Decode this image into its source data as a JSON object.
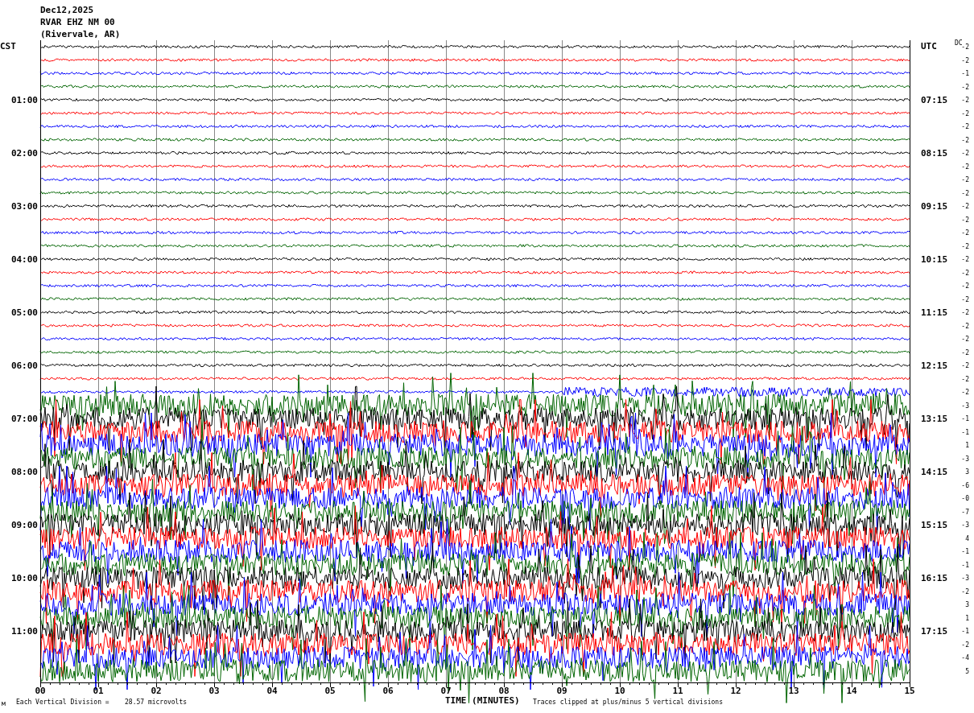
{
  "header": {
    "date": "Dec12,2025",
    "station": "RVAR EHZ NM 00",
    "location": "(Rivervale, AR)"
  },
  "left_zone": "CST",
  "right_zone": "UTC",
  "dc_heading": "DC",
  "traces": [
    {
      "color": "#000000",
      "kind": "quiet",
      "dc": "-2"
    },
    {
      "color": "#ff0000",
      "kind": "quiet",
      "dc": "-2"
    },
    {
      "color": "#0000ff",
      "kind": "quiet",
      "dc": "-1"
    },
    {
      "color": "#006400",
      "kind": "quiet",
      "dc": "-2"
    },
    {
      "color": "#000000",
      "kind": "quiet",
      "dc": "-2",
      "local_time": "01:00",
      "utc_time": "07:15"
    },
    {
      "color": "#ff0000",
      "kind": "quiet",
      "dc": "-2"
    },
    {
      "color": "#0000ff",
      "kind": "quiet",
      "dc": "-2"
    },
    {
      "color": "#006400",
      "kind": "quiet",
      "dc": "-2"
    },
    {
      "color": "#000000",
      "kind": "quiet",
      "dc": "-2",
      "local_time": "02:00",
      "utc_time": "08:15"
    },
    {
      "color": "#ff0000",
      "kind": "quiet",
      "dc": "-2"
    },
    {
      "color": "#0000ff",
      "kind": "quiet",
      "dc": "-2"
    },
    {
      "color": "#006400",
      "kind": "quiet",
      "dc": "-2"
    },
    {
      "color": "#000000",
      "kind": "quiet",
      "dc": "-2",
      "local_time": "03:00",
      "utc_time": "09:15"
    },
    {
      "color": "#ff0000",
      "kind": "quiet",
      "dc": "-2"
    },
    {
      "color": "#0000ff",
      "kind": "quiet",
      "dc": "-2"
    },
    {
      "color": "#006400",
      "kind": "quiet",
      "dc": "-2"
    },
    {
      "color": "#000000",
      "kind": "quiet",
      "dc": "-2",
      "local_time": "04:00",
      "utc_time": "10:15"
    },
    {
      "color": "#ff0000",
      "kind": "quiet",
      "dc": "-2"
    },
    {
      "color": "#0000ff",
      "kind": "quiet",
      "dc": "-2"
    },
    {
      "color": "#006400",
      "kind": "quiet",
      "dc": "-2"
    },
    {
      "color": "#000000",
      "kind": "quiet",
      "dc": "-2",
      "local_time": "05:00",
      "utc_time": "11:15"
    },
    {
      "color": "#ff0000",
      "kind": "quiet",
      "dc": "-2"
    },
    {
      "color": "#0000ff",
      "kind": "quiet",
      "dc": "-2"
    },
    {
      "color": "#006400",
      "kind": "quiet",
      "dc": "-2"
    },
    {
      "color": "#000000",
      "kind": "quiet",
      "dc": "-2",
      "local_time": "06:00",
      "utc_time": "12:15"
    },
    {
      "color": "#ff0000",
      "kind": "quiet",
      "dc": "-2"
    },
    {
      "color": "#0000ff",
      "kind": "mixed",
      "dc": "-2"
    },
    {
      "color": "#006400",
      "kind": "noisy",
      "dc": "-3"
    },
    {
      "color": "#000000",
      "kind": "noisy",
      "dc": "-1",
      "local_time": "07:00",
      "utc_time": "13:15"
    },
    {
      "color": "#ff0000",
      "kind": "noisy",
      "dc": "-1"
    },
    {
      "color": "#0000ff",
      "kind": "noisy",
      "dc": "1"
    },
    {
      "color": "#006400",
      "kind": "noisy",
      "dc": "-3"
    },
    {
      "color": "#000000",
      "kind": "noisy",
      "dc": "3",
      "local_time": "08:00",
      "utc_time": "14:15"
    },
    {
      "color": "#ff0000",
      "kind": "noisy",
      "dc": "-6"
    },
    {
      "color": "#0000ff",
      "kind": "noisy",
      "dc": "-0"
    },
    {
      "color": "#006400",
      "kind": "noisy",
      "dc": "-7"
    },
    {
      "color": "#000000",
      "kind": "noisy",
      "dc": "-3",
      "local_time": "09:00",
      "utc_time": "15:15"
    },
    {
      "color": "#ff0000",
      "kind": "noisy",
      "dc": "4"
    },
    {
      "color": "#0000ff",
      "kind": "noisy",
      "dc": "-1"
    },
    {
      "color": "#006400",
      "kind": "noisy",
      "dc": "-1"
    },
    {
      "color": "#000000",
      "kind": "noisy",
      "dc": "-3",
      "local_time": "10:00",
      "utc_time": "16:15"
    },
    {
      "color": "#ff0000",
      "kind": "noisy",
      "dc": "-2"
    },
    {
      "color": "#0000ff",
      "kind": "noisy",
      "dc": "3"
    },
    {
      "color": "#006400",
      "kind": "noisy",
      "dc": "1"
    },
    {
      "color": "#000000",
      "kind": "noisy",
      "dc": "-1",
      "local_time": "11:00",
      "utc_time": "17:15"
    },
    {
      "color": "#ff0000",
      "kind": "noisy",
      "dc": "-2"
    },
    {
      "color": "#0000ff",
      "kind": "noisy",
      "dc": "-4"
    },
    {
      "color": "#006400",
      "kind": "noisy",
      "dc": "5"
    }
  ],
  "x_ticks": [
    "00",
    "01",
    "02",
    "03",
    "04",
    "05",
    "06",
    "07",
    "08",
    "09",
    "10",
    "11",
    "12",
    "13",
    "14",
    "15"
  ],
  "x_axis_title": "TIME (MINUTES)",
  "footer": {
    "mark": "м",
    "scale_label": "Each Vertical Division =",
    "scale_value": "28.57 microvolts",
    "clip_note": "Traces clipped at plus/minus 5 vertical divisions"
  }
}
